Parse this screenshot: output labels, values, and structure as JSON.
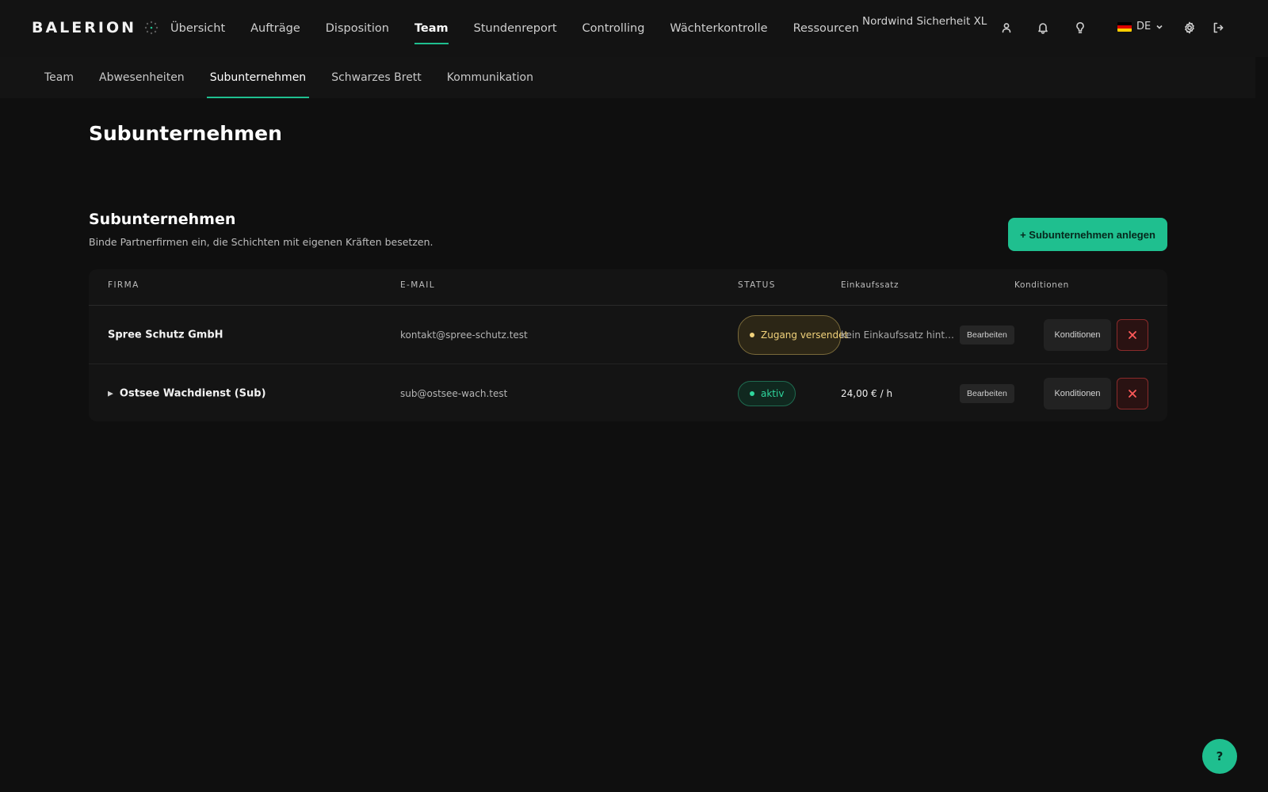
{
  "app": {
    "logo": "BALERION",
    "org_name": "Nordwind Sicherheit XL"
  },
  "main_nav": [
    {
      "label": "Übersicht",
      "active": false
    },
    {
      "label": "Aufträge",
      "active": false
    },
    {
      "label": "Disposition",
      "active": false
    },
    {
      "label": "Team",
      "active": true
    },
    {
      "label": "Stundenreport",
      "active": false
    },
    {
      "label": "Controlling",
      "active": false
    },
    {
      "label": "Wächterkontrolle",
      "active": false
    },
    {
      "label": "Ressourcen",
      "active": false
    }
  ],
  "language": {
    "code": "DE",
    "flag_colors": [
      "#000000",
      "#dd0000",
      "#ffce00"
    ]
  },
  "icons": {
    "user": "user-icon",
    "bell": "bell-icon",
    "idea": "lightbulb-icon",
    "settings": "gear-icon",
    "logout": "logout-icon"
  },
  "sub_nav": [
    {
      "label": "Team",
      "active": false
    },
    {
      "label": "Abwesenheiten",
      "active": false
    },
    {
      "label": "Subunternehmen",
      "active": true
    },
    {
      "label": "Schwarzes Brett",
      "active": false
    },
    {
      "label": "Kommunikation",
      "active": false
    }
  ],
  "page": {
    "title": "Subunternehmen",
    "section_title": "Subunternehmen",
    "section_description": "Binde Partnerfirmen ein, die Schichten mit eigenen Kräften besetzen.",
    "add_button": "+ Subunternehmen anlegen"
  },
  "table": {
    "headers": {
      "firm": "FIRMA",
      "email": "E-MAIL",
      "status": "STATUS",
      "rate": "Einkaufssatz",
      "conditions": "Konditionen"
    },
    "rows": [
      {
        "firm": "Spree Schutz GmbH",
        "expandable": false,
        "email": "kontakt@spree-schutz.test",
        "status": "Zugang versendet",
        "status_type": "pending",
        "rate": "kein Einkaufssatz hinterlegt",
        "rate_empty": true,
        "edit": "Bearbeiten",
        "conditions": "Konditionen"
      },
      {
        "firm": "Ostsee Wachdienst (Sub)",
        "expandable": true,
        "expand_glyph": "▶",
        "email": "sub@ostsee-wach.test",
        "status": "aktiv",
        "status_type": "active",
        "rate": "24,00 € / h",
        "rate_empty": false,
        "edit": "Bearbeiten",
        "conditions": "Konditionen"
      }
    ]
  },
  "help": {
    "label": "?"
  },
  "colors": {
    "accent": "#1fbf8f",
    "background": "#0f0f0f",
    "pending": "#f1d27b",
    "danger": "#ff5a5a"
  }
}
